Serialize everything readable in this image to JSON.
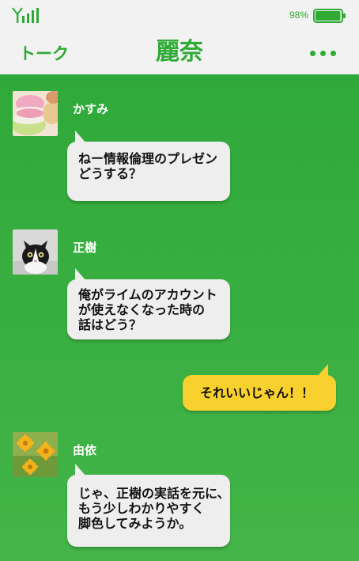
{
  "status_bar": {
    "signal_icon": "signal-strength-icon",
    "battery_percent": "98%",
    "battery_level": 0.98,
    "battery_icon": "battery-icon"
  },
  "header": {
    "back_label": "トーク",
    "title": "麗奈",
    "more_icon": "more-dots-icon"
  },
  "colors": {
    "brand_green": "#2eaa35",
    "chat_bg": "#3aaf41",
    "bubble_gray": "#eeeeee",
    "bubble_mine": "#f9d12e"
  },
  "messages": [
    {
      "sender": "かすみ",
      "avatar": "macaron-avatar",
      "lines": [
        "ねー情報倫理のプレゼン",
        "どうする？"
      ]
    },
    {
      "sender": "正樹",
      "avatar": "cat-avatar",
      "lines": [
        "俺がライムのアカウント",
        "が使えなくなった時の",
        "話はどう？"
      ]
    },
    {
      "sender": "",
      "mine": true,
      "lines": [
        "それいいじゃん！！"
      ]
    },
    {
      "sender": "由依",
      "avatar": "flower-avatar",
      "lines": [
        "じゃ、正樹の実話を元に、",
        "もう少しわかりやすく",
        "脚色してみようか。"
      ]
    }
  ]
}
